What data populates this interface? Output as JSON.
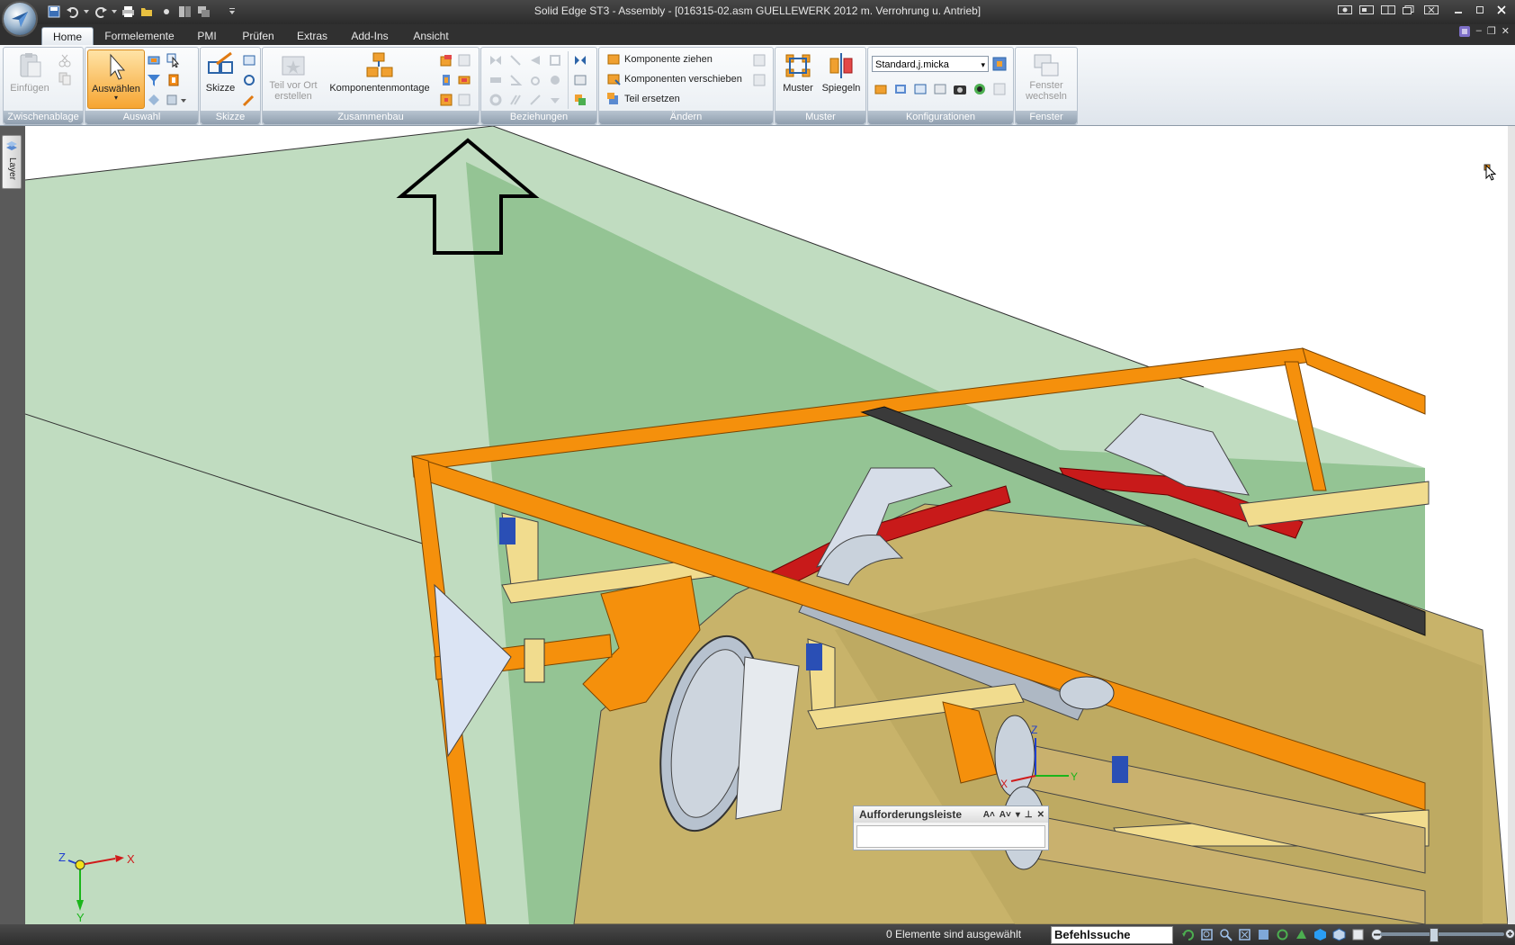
{
  "window": {
    "title": "Solid Edge ST3 - Assembly - [016315-02.asm GUELLEWERK 2012 m. Verrohrung u. Antrieb]"
  },
  "tabs": [
    {
      "label": "Home",
      "active": true
    },
    {
      "label": "Formelemente"
    },
    {
      "label": "PMI"
    },
    {
      "label": "Prüfen"
    },
    {
      "label": "Extras"
    },
    {
      "label": "Add-Ins"
    },
    {
      "label": "Ansicht"
    }
  ],
  "ribbon": {
    "groups": {
      "zwischenablage": "Zwischenablage",
      "auswahl": "Auswahl",
      "skizze": "Skizze",
      "zusammenbau": "Zusammenbau",
      "beziehungen": "Beziehungen",
      "aendern": "Ändern",
      "muster": "Muster",
      "konfigurationen": "Konfigurationen",
      "fenster": "Fenster"
    },
    "buttons": {
      "einfuegen": "Einfügen",
      "auswaehlen": "Auswählen",
      "skizze": "Skizze",
      "teil_vor_ort_1": "Teil vor Ort",
      "teil_vor_ort_2": "erstellen",
      "komponentenmontage": "Komponentenmontage",
      "komponente_ziehen": "Komponente ziehen",
      "komponenten_verschieben": "Komponenten verschieben",
      "teil_ersetzen": "Teil ersetzen",
      "muster": "Muster",
      "spiegeln": "Spiegeln",
      "fenster_1": "Fenster",
      "fenster_2": "wechseln"
    },
    "config_select": "Standard,j.micka"
  },
  "side_tab": "Layer",
  "triad": {
    "x": "X",
    "y": "Y",
    "z": "Z"
  },
  "prompt_bar": {
    "title": "Aufforderungsleiste"
  },
  "status": {
    "selection": "0 Elemente sind ausgewählt",
    "search_placeholder": "Befehlssuche"
  },
  "colors": {
    "frame_orange": "#f5900c",
    "tank_khaki": "#c8b36a",
    "plane_green": "#8cc08c",
    "accent_red": "#c81a1a"
  }
}
